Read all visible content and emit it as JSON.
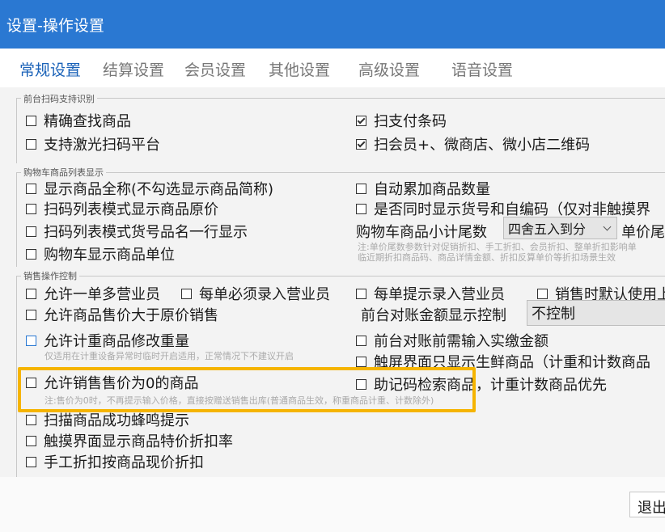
{
  "window": {
    "title": "设置-操作设置"
  },
  "tabs": [
    {
      "label": "常规设置",
      "active": true
    },
    {
      "label": "结算设置",
      "active": false
    },
    {
      "label": "会员设置",
      "active": false
    },
    {
      "label": "其他设置",
      "active": false
    },
    {
      "label": "高级设置",
      "active": false
    },
    {
      "label": "语音设置",
      "active": false
    }
  ],
  "groups": {
    "scan": {
      "title": "前台扫码支持识别",
      "items": [
        {
          "label": "精确查找商品",
          "checked": false
        },
        {
          "label": "支持激光扫码平台",
          "checked": false
        },
        {
          "label": "扫支付条码",
          "checked": true
        },
        {
          "label": "扫会员+、微商店、微小店二维码",
          "checked": true
        }
      ]
    },
    "cart": {
      "title": "购物车商品列表显示",
      "items": [
        {
          "label": "显示商品全称(不勾选显示商品简称)",
          "checked": false
        },
        {
          "label": "扫码列表模式显示商品原价",
          "checked": false
        },
        {
          "label": "扫码列表模式货号品名一行显示",
          "checked": false
        },
        {
          "label": "购物车显示商品单位",
          "checked": false
        },
        {
          "label": "自动累加商品数量",
          "checked": false
        },
        {
          "label": "是否同时显示货号和自编码（仅对非触摸界",
          "checked": false
        }
      ],
      "subtotal_label": "购物车商品小计尾数",
      "subtotal_value": "四舍五入到分",
      "unit_price_label": "单价尾",
      "note_line1": "注:单价尾数参数针对促销折扣、手工折扣、会员折扣、整单折扣影响单",
      "note_line2": "临近期折扣商品码、商品详情金额、折扣反算单价等折扣场景生效"
    },
    "sales": {
      "title": "销售操作控制",
      "items": [
        {
          "label": "允许一单多营业员",
          "checked": false
        },
        {
          "label": "每单必须录入营业员",
          "checked": false
        },
        {
          "label": "每单提示录入营业员",
          "checked": false
        },
        {
          "label": "销售时默认使用上",
          "checked": false
        },
        {
          "label": "允许商品售价大于原价销售",
          "checked": false
        },
        {
          "label": "允许计重商品修改重量",
          "checked": false
        },
        {
          "label": "前台对账前需输入实缴金额",
          "checked": false
        },
        {
          "label": "触屏界面只显示生鲜商品（计重和计数商品",
          "checked": false
        },
        {
          "label": "允许销售售价为0的商品",
          "checked": false
        },
        {
          "label": "助记码检索商品，计重计数商品优先",
          "checked": false
        },
        {
          "label": "扫描商品成功蜂鸣提示",
          "checked": false
        },
        {
          "label": "触摸界面显示商品特价折扣率",
          "checked": false
        },
        {
          "label": "手工折扣按商品现价折扣",
          "checked": false
        }
      ],
      "reconcile_label": "前台对账金额显示控制",
      "reconcile_value": "不控制",
      "weight_note": "仅适用在计重设备异常时临时开启适用，正常情况下不建议开启",
      "zero_price_note": "注:售价为0时，不再提示输入价格，直接按赠送销售出库(普通商品生效，称重商品计重、计数除外)"
    }
  },
  "footer": {
    "exit_label": "退出"
  },
  "colors": {
    "titlebar": "#2a78d2",
    "active_tab": "#1a62b8",
    "highlight": "#f5b400"
  }
}
